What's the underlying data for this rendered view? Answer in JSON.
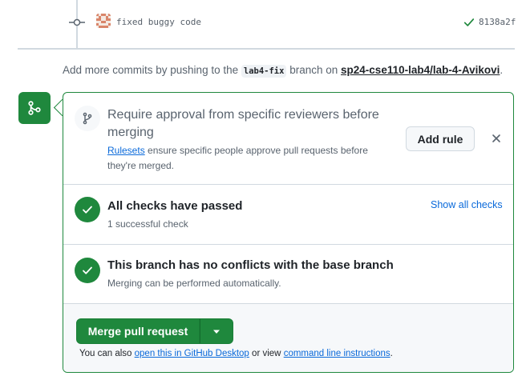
{
  "commit": {
    "message": "fixed buggy code",
    "sha": "8138a2f",
    "status": "success"
  },
  "push_note": {
    "prefix": "Add more commits by pushing to the",
    "branch": "lab4-fix",
    "middle": "branch on",
    "repo": "sp24-cse110-lab4/lab-4-Avikovi",
    "suffix": "."
  },
  "rule": {
    "title": "Require approval from specific reviewers before merging",
    "link": "Rulesets",
    "desc": "ensure specific people approve pull requests before they're merged.",
    "add_rule_label": "Add rule"
  },
  "checks": {
    "title": "All checks have passed",
    "subtitle": "1 successful check",
    "show_all_label": "Show all checks"
  },
  "conflicts": {
    "title": "This branch has no conflicts with the base branch",
    "subtitle": "Merging can be performed automatically."
  },
  "merge": {
    "button_label": "Merge pull request",
    "note_prefix": "You can also",
    "desktop_link": "open this in GitHub Desktop",
    "note_middle": "or view",
    "cli_link": "command line instructions",
    "note_suffix": "."
  },
  "colors": {
    "success": "#1f883d",
    "link": "#0969da",
    "border": "#d1d9e0"
  }
}
